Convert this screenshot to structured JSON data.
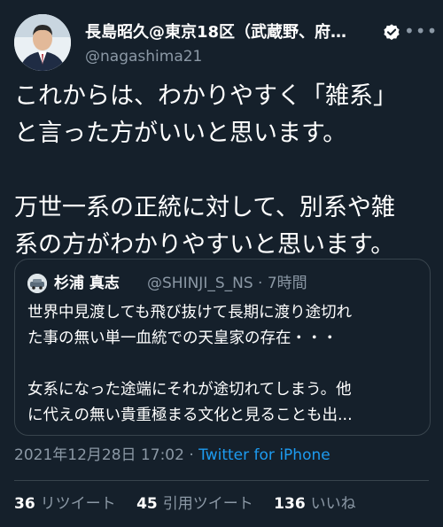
{
  "author": {
    "name": "長島昭久@東京18区（武蔵野、府…",
    "handle": "@nagashima21",
    "verified_icon": "verified-badge-icon"
  },
  "tweet": {
    "text": "これからは、わかりやすく「雑系」\nと言った方がいいと思います。\n\n万世一系の正統に対して、別系や雑\n系の方がわかりやすいと思います。"
  },
  "quoted_tweet": {
    "author_name": "杉浦 真志",
    "author_handle": "@SHINJI_S_NS",
    "separator": "·",
    "time_ago": "7時間",
    "text": "世界中見渡しても飛び抜けて長期に渡り途切れ\nた事の無い単一血統での天皇家の存在・・・\n\n女系になった途端にそれが途切れてしまう。他\nに代えの無い貴重極まる文化と見ることも出..."
  },
  "meta": {
    "timestamp": "2021年12月28日 17:02",
    "separator": "·",
    "source": "Twitter for iPhone"
  },
  "stats": {
    "retweets_count": "36",
    "retweets_label": "リツイート",
    "quotes_count": "45",
    "quotes_label": "引用ツイート",
    "likes_count": "136",
    "likes_label": "いいね"
  },
  "colors": {
    "background": "#15202b",
    "secondary_text": "#8b98a5",
    "link": "#1d9bf0",
    "border": "#38444d"
  }
}
